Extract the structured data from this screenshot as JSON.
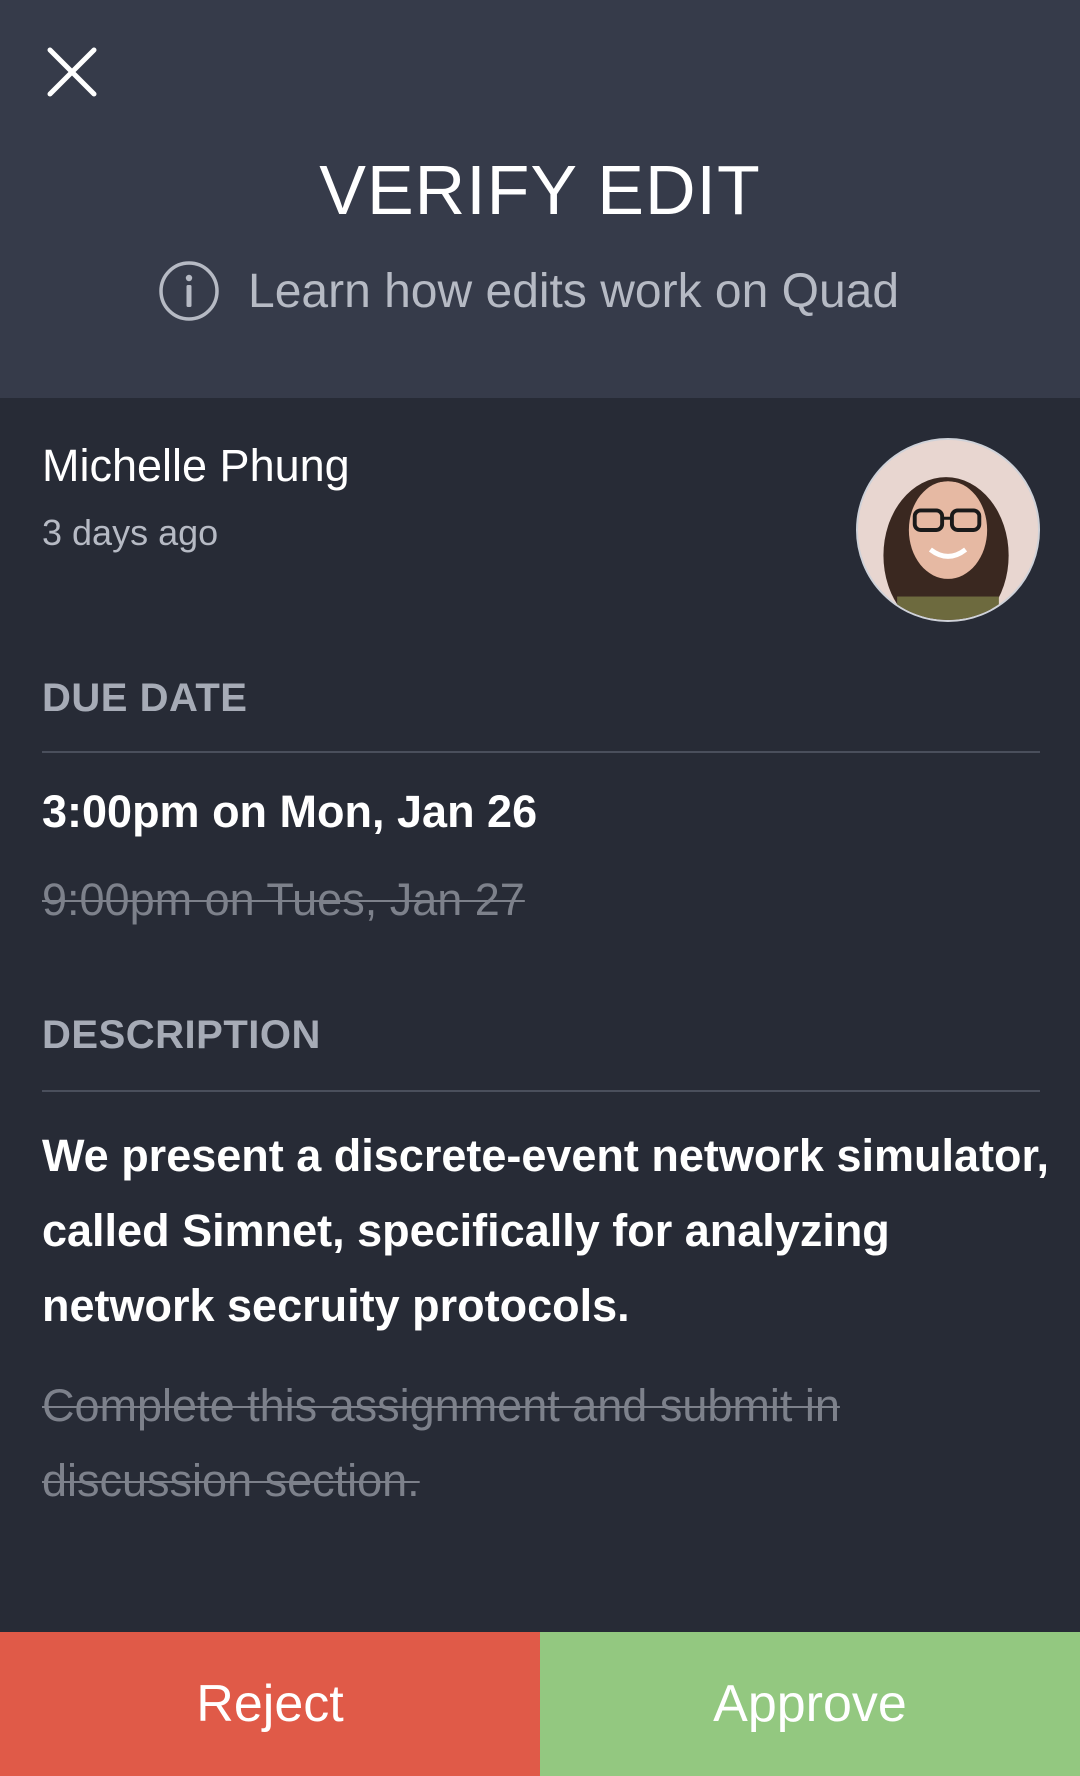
{
  "header": {
    "title": "VERIFY EDIT",
    "learn_link": "Learn how edits work on Quad"
  },
  "author": {
    "name": "Michelle Phung",
    "time": "3 days ago"
  },
  "due_date": {
    "label": "DUE DATE",
    "new_value": "3:00pm on Mon, Jan 26",
    "old_value": "9:00pm on Tues, Jan 27"
  },
  "description": {
    "label": "DESCRIPTION",
    "new_value": "We present a discrete-event network simulator, called Simnet, specifically for analyzing network secruity protocols.",
    "old_value": "Complete this assignment and submit in discussion section."
  },
  "actions": {
    "reject_label": "Reject",
    "approve_label": "Approve"
  },
  "colors": {
    "header_bg": "#363b4a",
    "body_bg": "#272b36",
    "reject": "#e05a48",
    "approve": "#93c880"
  },
  "icons": {
    "close": "close-icon",
    "info": "info-icon"
  }
}
